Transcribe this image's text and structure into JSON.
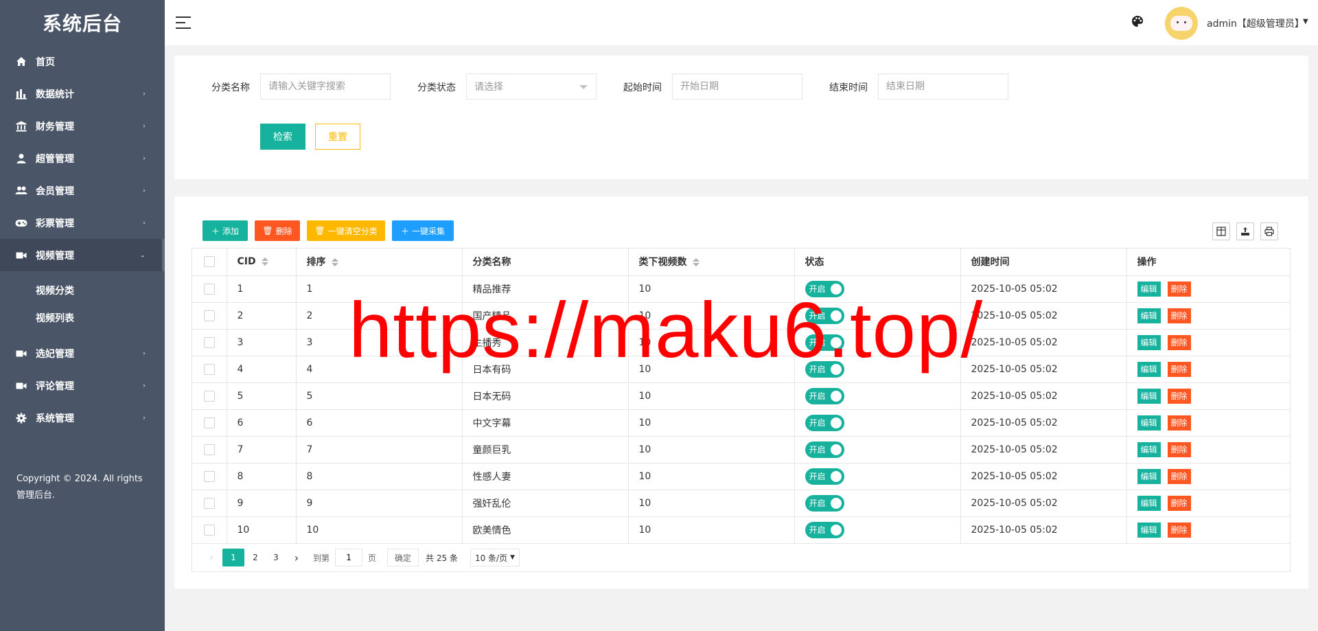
{
  "sidebar": {
    "title": "系统后台",
    "items": [
      {
        "label": "首页",
        "icon": "home-icon",
        "has_children": false
      },
      {
        "label": "数据统计",
        "icon": "bar-chart-icon",
        "has_children": true
      },
      {
        "label": "财务管理",
        "icon": "bank-icon",
        "has_children": true
      },
      {
        "label": "超管管理",
        "icon": "user-icon",
        "has_children": true
      },
      {
        "label": "会员管理",
        "icon": "users-icon",
        "has_children": true
      },
      {
        "label": "彩票管理",
        "icon": "gamepad-icon",
        "has_children": true
      },
      {
        "label": "视频管理",
        "icon": "video-icon",
        "has_children": true,
        "expanded": true
      },
      {
        "label": "选妃管理",
        "icon": "video-icon",
        "has_children": true
      },
      {
        "label": "评论管理",
        "icon": "video-icon",
        "has_children": true
      },
      {
        "label": "系统管理",
        "icon": "gear-icon",
        "has_children": true
      }
    ],
    "submenu": [
      "视频分类",
      "视频列表"
    ],
    "copyright": "Copyright © 2024. All rights 管理后台."
  },
  "header": {
    "user": "admin【超级管理员】"
  },
  "search": {
    "name_label": "分类名称",
    "name_placeholder": "请输入关键字搜索",
    "status_label": "分类状态",
    "status_placeholder": "请选择",
    "start_label": "起始时间",
    "start_placeholder": "开始日期",
    "end_label": "结束时间",
    "end_placeholder": "结束日期",
    "search_button": "检索",
    "reset_button": "重置"
  },
  "toolbar": {
    "add": "添加",
    "delete": "删除",
    "clear": "一键清空分类",
    "collect": "一键采集",
    "colors": {
      "add": "#16b29d",
      "delete": "#ff5722",
      "clear": "#ffb800",
      "collect": "#1e9fff"
    }
  },
  "table": {
    "headers": [
      "CID",
      "排序",
      "分类名称",
      "类下视频数",
      "状态",
      "创建时间",
      "操作"
    ],
    "rows": [
      {
        "cid": "1",
        "sort": "1",
        "name": "精品推荐",
        "count": "10",
        "status": "开启",
        "created": "2025-10-05 05:02"
      },
      {
        "cid": "2",
        "sort": "2",
        "name": "国产精品",
        "count": "10",
        "status": "开启",
        "created": "2025-10-05 05:02"
      },
      {
        "cid": "3",
        "sort": "3",
        "name": "主播秀",
        "count": "10",
        "status": "开启",
        "created": "2025-10-05 05:02"
      },
      {
        "cid": "4",
        "sort": "4",
        "name": "日本有码",
        "count": "10",
        "status": "开启",
        "created": "2025-10-05 05:02"
      },
      {
        "cid": "5",
        "sort": "5",
        "name": "日本无码",
        "count": "10",
        "status": "开启",
        "created": "2025-10-05 05:02"
      },
      {
        "cid": "6",
        "sort": "6",
        "name": "中文字幕",
        "count": "10",
        "status": "开启",
        "created": "2025-10-05 05:02"
      },
      {
        "cid": "7",
        "sort": "7",
        "name": "童颜巨乳",
        "count": "10",
        "status": "开启",
        "created": "2025-10-05 05:02"
      },
      {
        "cid": "8",
        "sort": "8",
        "name": "性感人妻",
        "count": "10",
        "status": "开启",
        "created": "2025-10-05 05:02"
      },
      {
        "cid": "9",
        "sort": "9",
        "name": "强奸乱伦",
        "count": "10",
        "status": "开启",
        "created": "2025-10-05 05:02"
      },
      {
        "cid": "10",
        "sort": "10",
        "name": "欧美情色",
        "count": "10",
        "status": "开启",
        "created": "2025-10-05 05:02"
      }
    ],
    "edit_label": "编辑",
    "delete_label": "删除"
  },
  "pagination": {
    "pages": [
      "1",
      "2",
      "3"
    ],
    "current": "1",
    "goto_label": "到第",
    "goto_value": "1",
    "page_unit": "页",
    "confirm": "确定",
    "total": "共 25 条",
    "limit": "10 条/页"
  },
  "watermark": "https://maku6.top/",
  "colors": {
    "sidebar": "#4a5568",
    "accent": "#16b29d",
    "danger": "#ff5722",
    "warn": "#ffb800",
    "blue": "#1e9fff"
  }
}
